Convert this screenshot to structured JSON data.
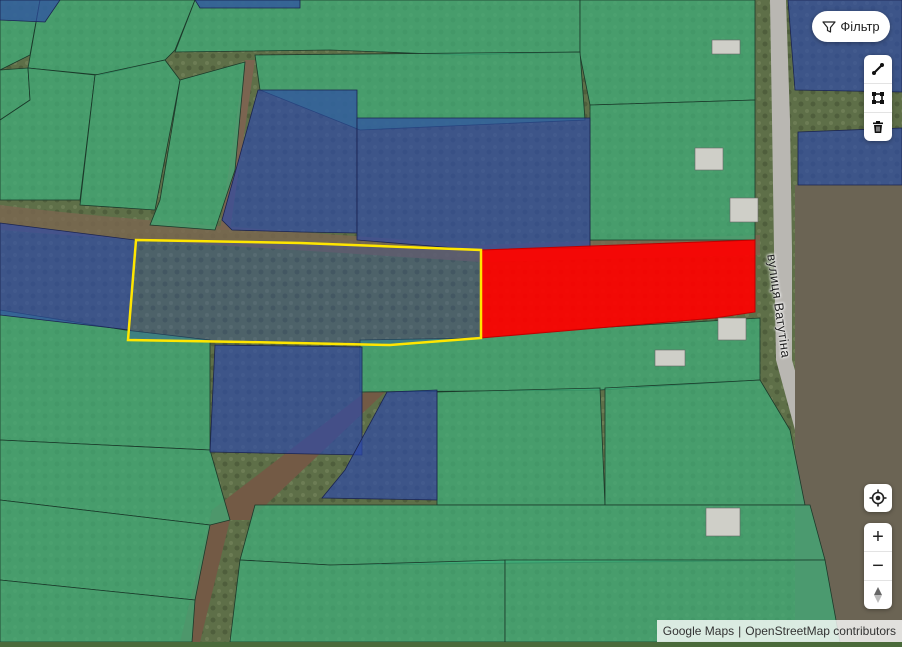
{
  "map": {
    "street_label": "вулиця Ватутіна",
    "colors": {
      "parcel_green": "#3fae7a",
      "parcel_blue": "#2d4aa8",
      "selected_parcel": "#ff0000",
      "highlight_outline": "#ffe600"
    }
  },
  "controls": {
    "filter_label": "Фільтр",
    "filter_icon": "funnel-icon",
    "draw_tools": [
      "draw-line-icon",
      "draw-polygon-icon",
      "trash-icon"
    ],
    "locate_icon": "locate-icon",
    "zoom_in_label": "+",
    "zoom_out_label": "−",
    "compass_icon": "compass-icon"
  },
  "attribution": {
    "google": "Google Maps",
    "separator": "|",
    "osm": "OpenStreetMap contributors"
  }
}
